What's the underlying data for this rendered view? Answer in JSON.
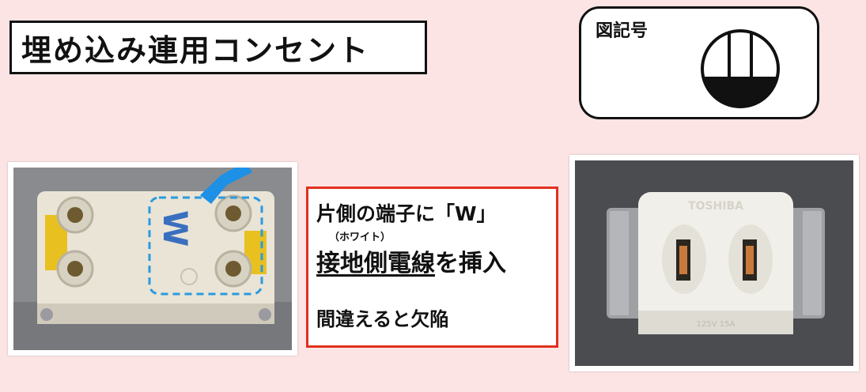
{
  "title": "埋め込み連用コンセント",
  "symbol": {
    "label": "図記号",
    "icon": "concealed-outlet-symbol"
  },
  "note": {
    "line1": "片側の端子に「W」",
    "line1_sub": "（ホワイト）",
    "line2_underlined": "接地側電線",
    "line2_rest": "を挿入",
    "line3": "間違えると欠陥"
  },
  "left_photo": {
    "mark": "W",
    "icon": "outlet-back-terminals-photo"
  },
  "right_photo": {
    "brand": "TOSHIBA",
    "rating": "125V 15A",
    "icon": "outlet-front-photo"
  },
  "colors": {
    "background": "#fce4e4",
    "note_border": "#e0301e",
    "arrow": "#1e90e6"
  }
}
